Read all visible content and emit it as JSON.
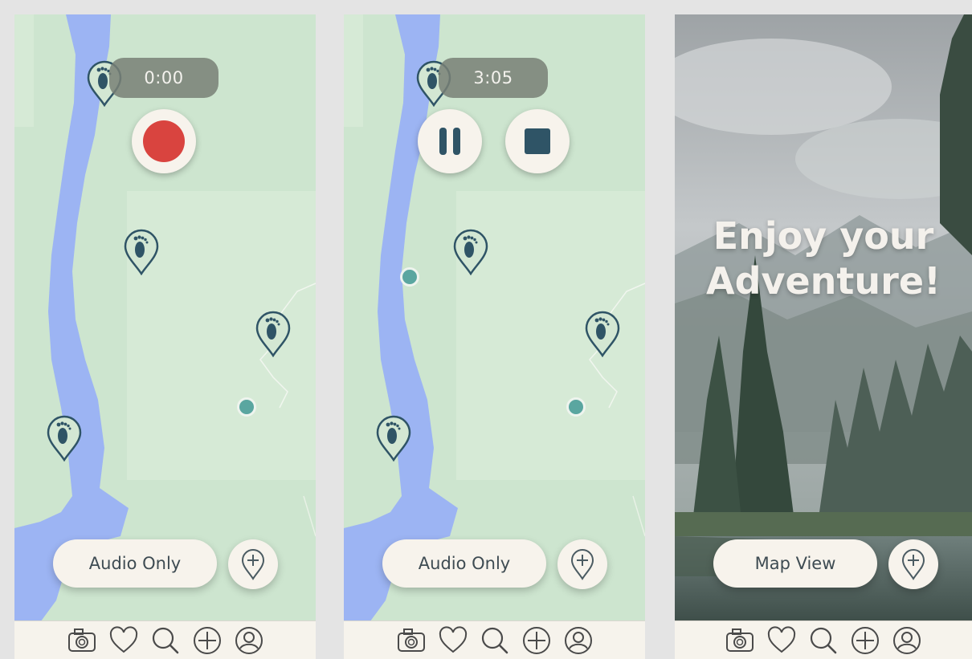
{
  "colors": {
    "map_green": "#cde5cf",
    "map_light": "#d9ecd9",
    "river_blue": "#9cb4f3",
    "pin_dark": "#2f5466",
    "record_red": "#d9443f",
    "stop_navy": "#2f5466",
    "dot_teal": "#5aa6a0",
    "panel_cream": "#f7f3ec",
    "timer_grey": "#78807a"
  },
  "screens": [
    {
      "id": "recording-idle",
      "timer": "0:00",
      "controls": [
        "record-icon"
      ],
      "mode_button": "Audio Only",
      "add_button_icon": "add-pin-icon"
    },
    {
      "id": "recording-active",
      "timer": "3:05",
      "controls": [
        "pause-icon",
        "stop-icon"
      ],
      "mode_button": "Audio Only",
      "add_button_icon": "add-pin-icon"
    },
    {
      "id": "audio-only",
      "hero_line1": "Enjoy your",
      "hero_line2": "Adventure!",
      "mode_button": "Map View",
      "add_button_icon": "add-pin-icon"
    }
  ],
  "tabbar": [
    "camera-icon",
    "heart-icon",
    "search-icon",
    "add-icon",
    "profile-icon"
  ]
}
